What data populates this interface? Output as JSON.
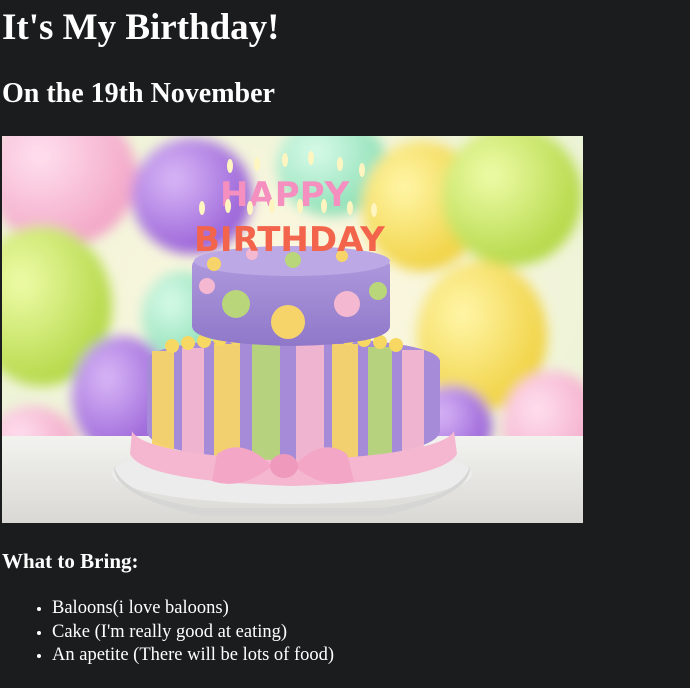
{
  "page": {
    "title": "It's My Birthday!",
    "subtitle": "On the 19th November",
    "bring_heading": "What to Bring:",
    "bring_items": [
      "Baloons(i love baloons)",
      "Cake (I'm really good at eating)",
      "An apetite (There will be lots of food)"
    ]
  },
  "image": {
    "subject": "birthday-cake-photo",
    "candle_text_top": "HAPPY",
    "candle_text_bottom": "BIRTHDAY"
  },
  "colors": {
    "background": "#1b1c1e",
    "text": "#ffffff",
    "cake_purple": "#a98fd6",
    "stripe_yellow": "#f5d669",
    "stripe_green": "#b8d77a",
    "ribbon_pink": "#f4b6cf"
  }
}
